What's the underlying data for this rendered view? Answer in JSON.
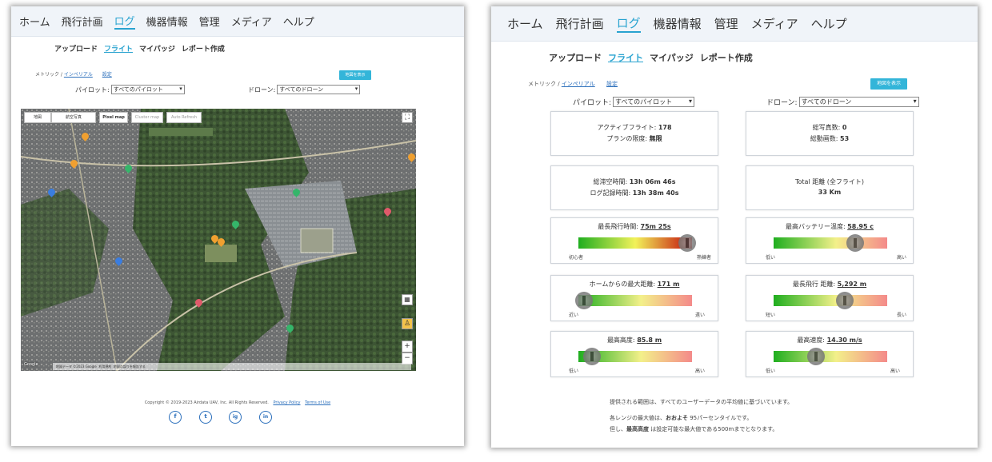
{
  "nav": [
    "ホーム",
    "飛行計画",
    "ログ",
    "機器情報",
    "管理",
    "メディア",
    "ヘルプ"
  ],
  "subnav": [
    "アップロード",
    "フライト",
    "マイパッジ",
    "レポート作成"
  ],
  "left": {
    "breadcrumb": {
      "metric": "メトリック",
      "sep": " / ",
      "imperial": "インペリアル",
      "settings": "設定"
    },
    "map_button": "地図を表示",
    "pilot_label": "パイロット:",
    "pilot_value": "すべてのパイロット",
    "drone_label": "ドローン:",
    "drone_value": "すべてのドローン",
    "map_tabs": [
      "地図",
      "航空写真",
      "Pixel map",
      "Cluster map",
      "Auto Refresh"
    ],
    "map_labels": [
      "Google",
      "地図データ ©2023 Google",
      "利用規約",
      "地図の誤りを報告する"
    ],
    "copyright": "Copyright © 2019-2023 Airdata UAV, Inc. All Rights Reserved.",
    "privacy": "Privacy Policy",
    "terms": "Terms of Use",
    "social": [
      "f",
      "t",
      "ig",
      "in"
    ]
  },
  "right": {
    "breadcrumb": {
      "metric": "メトリック",
      "sep": " / ",
      "imperial": "インペリアル",
      "settings": "設定"
    },
    "map_button": "地図を表示",
    "pilot_label": "パイロット:",
    "pilot_value": "すべてのパイロット",
    "drone_label": "ドローン:",
    "drone_value": "すべてのドローン",
    "stats": {
      "active_label": "アクティブフライト:",
      "active_value": "178",
      "plan_label": "プランの限度:",
      "plan_value": "無限",
      "photos_label": "総写真数:",
      "photos_value": "0",
      "videos_label": "総動画数:",
      "videos_value": "53",
      "airtime_label": "総滞空時間:",
      "airtime_value": "13h 06m 46s",
      "logtime_label": "ログ記録時間:",
      "logtime_value": "13h 38m 40s",
      "distance_label": "Total 距離 (全フライト)",
      "distance_value": "33 Km"
    },
    "gauges": [
      {
        "label": "最長飛行時間:",
        "value": "75m 25s",
        "low": "初心者",
        "high": "熟練者",
        "level": 0.96,
        "scale": "a"
      },
      {
        "label": "最高バッテリー温度:",
        "value": "58.95 c",
        "low": "低い",
        "high": "高い",
        "level": 0.72,
        "scale": "b"
      },
      {
        "label": "ホームからの最大距離:",
        "value": "171 m",
        "low": "近い",
        "high": "遠い",
        "level": 0.05,
        "scale": "b"
      },
      {
        "label": "最長飛行 距離:",
        "value": "5,292 m",
        "low": "短い",
        "high": "長い",
        "level": 0.63,
        "scale": "b"
      },
      {
        "label": "最高高度:",
        "value": "85.8 m",
        "low": "低い",
        "high": "高い",
        "level": 0.12,
        "scale": "b"
      },
      {
        "label": "最高速度:",
        "value": "14.30 m/s",
        "low": "低い",
        "high": "高い",
        "level": 0.37,
        "scale": "b"
      }
    ],
    "note1": "提供される範囲は、すべてのユーザーデータの平均値に基づいています。",
    "note2_a": "各レンジの最大値は、",
    "note2_b": "おおよそ",
    "note2_c": " 95パーセンタイルです。",
    "note3_a": "但し、",
    "note3_b": "最高高度",
    "note3_c": " は設定可能な最大値である500mまでとなります。"
  },
  "colors": {
    "accent": "#29a3d0",
    "button": "#33b5d9",
    "link": "#2a6ebb"
  }
}
